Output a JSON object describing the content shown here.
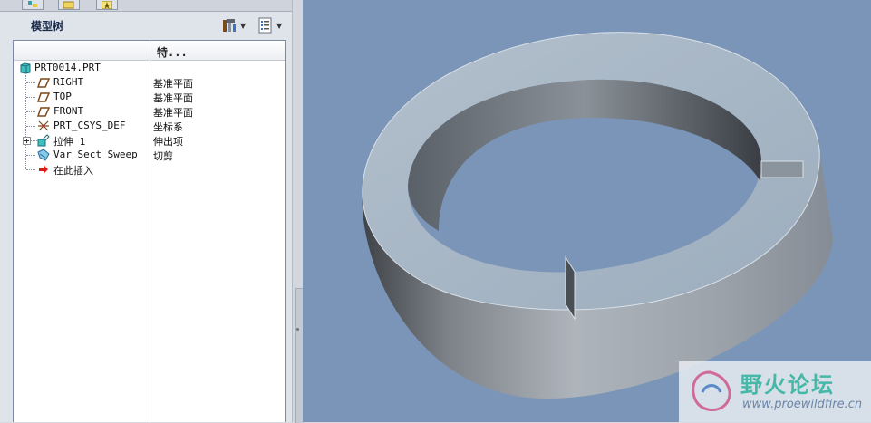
{
  "tabs": [
    {
      "name": "model-tree-tab"
    },
    {
      "name": "folder-browser-tab"
    },
    {
      "name": "favorites-tab"
    }
  ],
  "model_tree": {
    "title": "模型树",
    "column_feature": "特...",
    "items": [
      {
        "name": "PRT0014.PRT",
        "type": "",
        "icon": "part-icon"
      },
      {
        "name": "RIGHT",
        "type": "基准平面",
        "icon": "datum-plane-icon"
      },
      {
        "name": "TOP",
        "type": "基准平面",
        "icon": "datum-plane-icon"
      },
      {
        "name": "FRONT",
        "type": "基准平面",
        "icon": "datum-plane-icon"
      },
      {
        "name": "PRT_CSYS_DEF",
        "type": "坐标系",
        "icon": "coordinate-system-icon"
      },
      {
        "name": "拉伸 1",
        "type": "伸出项",
        "icon": "extrude-icon"
      },
      {
        "name": "Var Sect Sweep",
        "type": "切剪",
        "icon": "sweep-icon"
      },
      {
        "name": "在此插入",
        "type": "",
        "icon": "insert-here-arrow-icon"
      }
    ]
  },
  "toolbar": {
    "settings_icon": "tools-hammer-icon",
    "show_icon": "list-settings-icon"
  },
  "watermark": {
    "title": "野火论坛",
    "url": "www.proewildfire.cn"
  },
  "colors": {
    "viewport_bg": "#7b95b9",
    "ring_top": "#a9b9c9",
    "ring_side_dark": "#3f4348"
  }
}
